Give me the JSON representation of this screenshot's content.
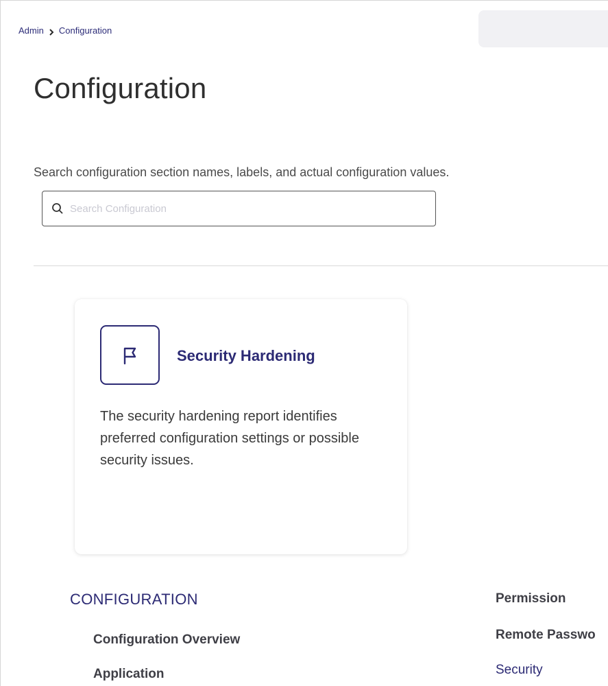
{
  "breadcrumb": {
    "items": [
      "Admin",
      "Configuration"
    ]
  },
  "page": {
    "title": "Configuration"
  },
  "search": {
    "description": "Search configuration section names, labels, and actual configuration values.",
    "placeholder": "Search Configuration",
    "value": ""
  },
  "card": {
    "icon": "flag-icon",
    "title": "Security Hardening",
    "description": "The security hardening report identifies preferred configuration settings or possible security issues."
  },
  "config_nav": {
    "heading": "CONFIGURATION",
    "left_items": [
      "Configuration Overview",
      "Application"
    ],
    "right_items": [
      "Permission",
      "Remote Passwo",
      "Security"
    ]
  },
  "colors": {
    "accent": "#2c2a74",
    "link": "#2c2c78",
    "divider": "#d9d9d9"
  }
}
